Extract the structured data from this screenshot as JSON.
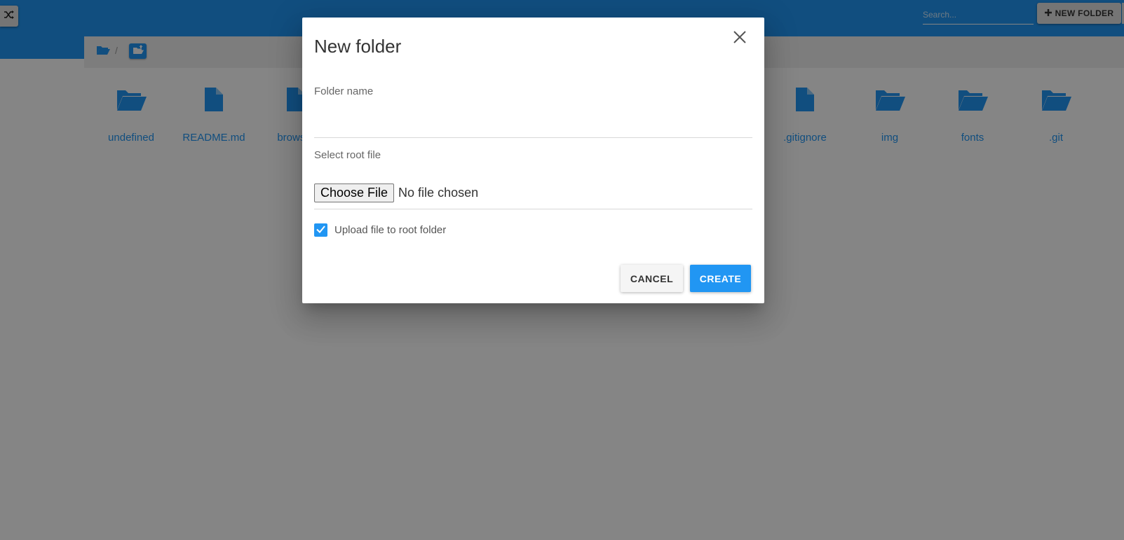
{
  "colors": {
    "accent": "#2196f3",
    "backdrop": "rgba(0,0,0,0.48)"
  },
  "header": {
    "shuffle_icon": "shuffle-icon",
    "search": {
      "placeholder": "Search..."
    },
    "new_folder_button": {
      "icon": "plus-icon",
      "label": "NEW FOLDER"
    }
  },
  "breadcrumb": {
    "root_icon": "folder-open-icon",
    "separator": "/",
    "current_icon": "folder-upload-icon"
  },
  "files": [
    {
      "name": "undefined",
      "icon": "folder-icon"
    },
    {
      "name": "README.md",
      "icon": "file-icon"
    },
    {
      "name": "browser",
      "icon": "file-icon"
    },
    {
      "name": ".gitignore",
      "icon": "file-icon"
    },
    {
      "name": "img",
      "icon": "folder-icon"
    },
    {
      "name": "fonts",
      "icon": "folder-icon"
    },
    {
      "name": ".git",
      "icon": "folder-icon"
    }
  ],
  "dialog": {
    "title": "New folder",
    "close_icon": "close-icon",
    "folder_name": {
      "label": "Folder name",
      "value": ""
    },
    "root_file": {
      "label": "Select root file",
      "button": "Choose File",
      "status": "No file chosen"
    },
    "upload_checkbox": {
      "label": "Upload file to root folder",
      "checked": true
    },
    "cancel": "CANCEL",
    "create": "CREATE"
  }
}
